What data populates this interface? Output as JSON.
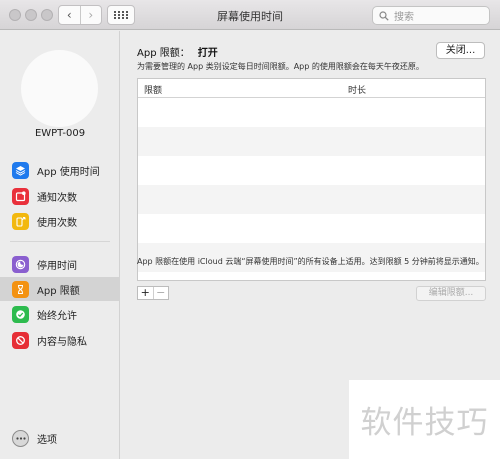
{
  "window": {
    "title": "屏幕使用时间"
  },
  "toolbar": {
    "back": "‹",
    "forward": "›",
    "search_placeholder": "搜索"
  },
  "sidebar": {
    "device_name": "EWPT-009",
    "items": [
      {
        "label": "App 使用时间",
        "icon": "layers-icon",
        "color": "#1f7aed"
      },
      {
        "label": "通知次数",
        "icon": "notification-icon",
        "color": "#e9303b"
      },
      {
        "label": "使用次数",
        "icon": "pickup-icon",
        "color": "#f2b80e"
      },
      {
        "label": "停用时间",
        "icon": "moon-icon",
        "color": "#8a5fcf"
      },
      {
        "label": "App 限额",
        "icon": "hourglass-icon",
        "color": "#f39212"
      },
      {
        "label": "始终允许",
        "icon": "check-icon",
        "color": "#2dbb4e"
      },
      {
        "label": "内容与隐私",
        "icon": "block-icon",
        "color": "#e62e36"
      }
    ],
    "options_label": "选项"
  },
  "main": {
    "heading_label": "App 限额：",
    "heading_status": "打开",
    "close_button": "关闭...",
    "description": "为需要管理的 App 类别设定每日时间限额。App 的使用限额会在每天午夜还原。",
    "table": {
      "col_limit": "限额",
      "col_duration": "时长",
      "rows": []
    },
    "footnote": "App 限额在使用 iCloud 云端“屏幕使用时间”的所有设备上适用。达到限额 5 分钟前将显示通知。",
    "add": "+",
    "remove": "−",
    "edit_button": "编辑限额..."
  },
  "watermark": "软件技巧"
}
